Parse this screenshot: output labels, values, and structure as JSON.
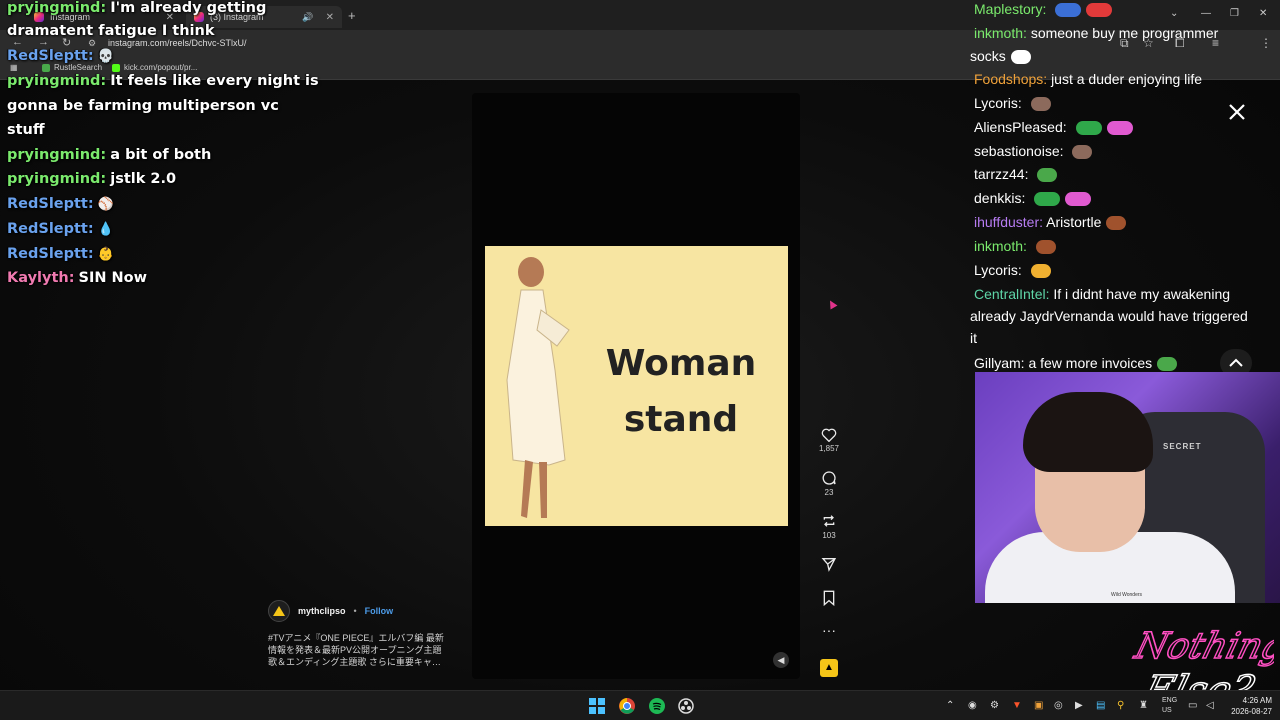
{
  "browser": {
    "tabs": [
      {
        "label": "Instagram"
      },
      {
        "label": "(3) Instagram"
      }
    ],
    "url": "instagram.com/reels/Dchvc-STlxU/",
    "bookmarks": [
      {
        "label": "RustleSearch"
      },
      {
        "label": "kick.com/popout/pr..."
      }
    ]
  },
  "left_chat": [
    {
      "user": "pryingmind:",
      "color": "#7bea6d",
      "text": "I'm already getting"
    },
    {
      "user": "",
      "color": "#ffffff",
      "text": "dramatent fatigue I think"
    },
    {
      "user": "RedSleptt:",
      "color": "#6aa2ee",
      "text": "",
      "emote": "skull-emote"
    },
    {
      "user": "pryingmind:",
      "color": "#7bea6d",
      "text": "It feels like every night is"
    },
    {
      "user": "",
      "color": "#ffffff",
      "text": "gonna be farming multiperson vc"
    },
    {
      "user": "",
      "color": "#ffffff",
      "text": "stuff"
    },
    {
      "user": "pryingmind:",
      "color": "#7bea6d",
      "text": "a bit of both"
    },
    {
      "user": "pryingmind:",
      "color": "#7bea6d",
      "text": "jstlk 2.0"
    },
    {
      "user": "RedSleptt:",
      "color": "#6aa2ee",
      "text": "",
      "emote": "ball-emote"
    },
    {
      "user": "RedSleptt:",
      "color": "#6aa2ee",
      "text": "",
      "emote": "drop-emote"
    },
    {
      "user": "RedSleptt:",
      "color": "#6aa2ee",
      "text": "",
      "emote": "baby-emote"
    },
    {
      "user": "Kaylyth:",
      "color": "#f07ab0",
      "text": "SIN Now"
    }
  ],
  "right_chat": [
    {
      "user": "Maplestory:",
      "color": "#7bea6d",
      "text": ""
    },
    {
      "user": "inkmoth:",
      "color": "#7bea6d",
      "text": "someone buy me programmer"
    },
    {
      "user": "",
      "color": "#ffffff",
      "text": "socks"
    },
    {
      "user": "Foodshops:",
      "color": "#f0a23a",
      "text": "just a duder enjoying life"
    },
    {
      "user": "Lycoris:",
      "color": "#ffffff",
      "text": ""
    },
    {
      "user": "AliensPleased:",
      "color": "#ffffff",
      "text": ""
    },
    {
      "user": "sebastionoise:",
      "color": "#ffffff",
      "text": ""
    },
    {
      "user": "tarrzz44:",
      "color": "#ffffff",
      "text": ""
    },
    {
      "user": "denkkis:",
      "color": "#ffffff",
      "text": ""
    },
    {
      "user": "ihuffduster:",
      "color": "#b77cf2",
      "text": "Aristortle"
    },
    {
      "user": "inkmoth:",
      "color": "#7bea6d",
      "text": ""
    },
    {
      "user": "Lycoris:",
      "color": "#ffffff",
      "text": ""
    },
    {
      "user": "CentralIntel:",
      "color": "#5fd6a8",
      "text": "If i didnt have my awakening"
    },
    {
      "user": "",
      "color": "#ffffff",
      "text": "already JaydrVernanda would have triggered"
    },
    {
      "user": "",
      "color": "#ffffff",
      "text": "it"
    },
    {
      "user": "Gillyam:",
      "color": "#ffffff",
      "text": "a few more invoices"
    }
  ],
  "reel": {
    "frame_text_line1": "Woman",
    "frame_text_line2": "stand",
    "likes": "1,857",
    "comments": "23",
    "reposts": "103",
    "author": "mythclipso",
    "separator": "•",
    "follow_label": "Follow",
    "caption": "#TVアニメ『ONE PIECE』エルバフ編 最新情報を発表＆最新PV公開オープニング主題歌＆エンディング主題歌 さらに重要キャ…"
  },
  "webcam": {
    "chair_brand": "SECRET",
    "shirt_text": "Wild Wonders"
  },
  "brand_overlay": {
    "line1": "Nothing",
    "line2": "Else?"
  },
  "taskbar": {
    "lang_line1": "ENG",
    "lang_line2": "US",
    "time": "4:26 AM",
    "date": "2026-08-27"
  },
  "colors": {
    "accent_follow": "#4c9be8",
    "frame_background": "#f7e5a2",
    "webcam_purple": "#8a5ad9"
  }
}
